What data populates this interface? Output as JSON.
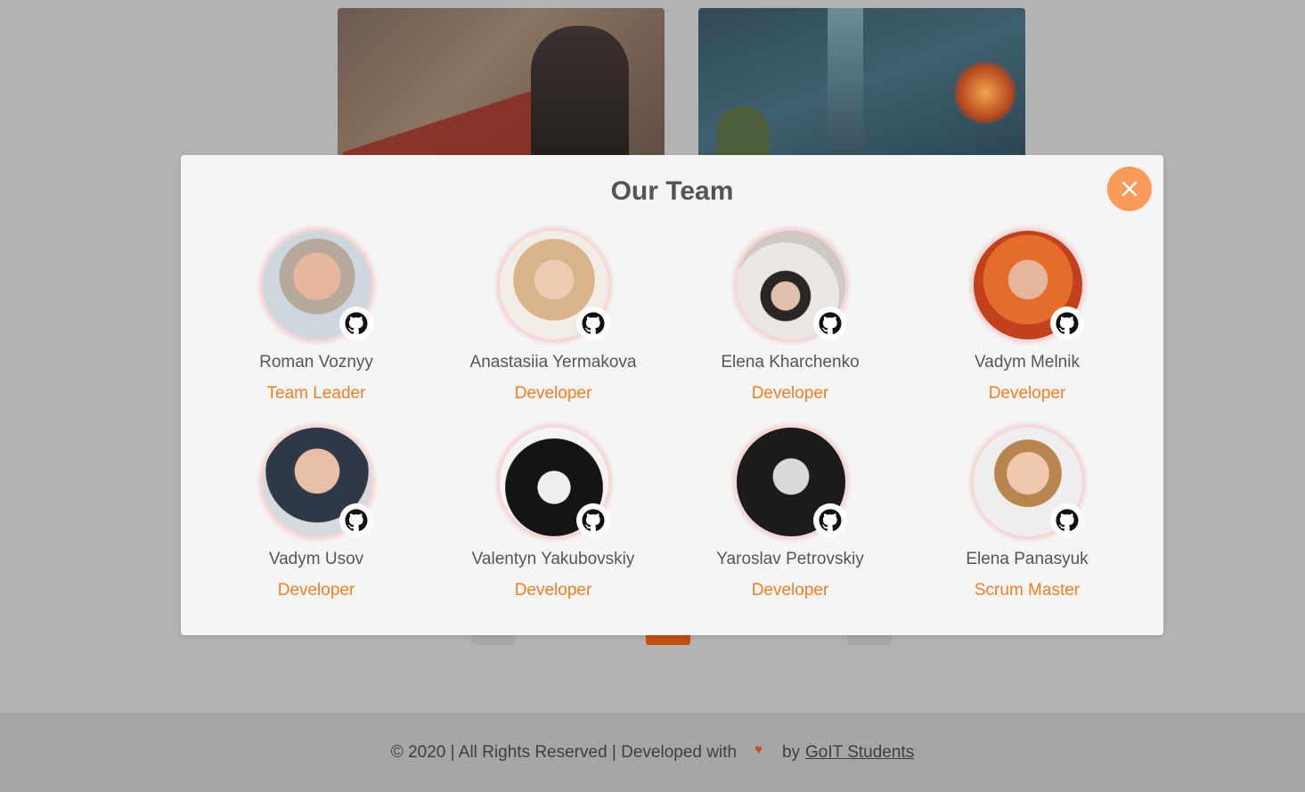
{
  "modal": {
    "title": "Our Team",
    "close_label": "×",
    "members": [
      {
        "name": "Roman Voznyy",
        "role": "Team Leader"
      },
      {
        "name": "Anastasiia Yermakova",
        "role": "Developer"
      },
      {
        "name": "Elena Kharchenko",
        "role": "Developer"
      },
      {
        "name": "Vadym Melnik",
        "role": "Developer"
      },
      {
        "name": "Vadym Usov",
        "role": "Developer"
      },
      {
        "name": "Valentyn Yakubovskiy",
        "role": "Developer"
      },
      {
        "name": "Yaroslav Petrovskiy",
        "role": "Developer"
      },
      {
        "name": "Elena Panasyuk",
        "role": "Scrum Master"
      }
    ]
  },
  "footer": {
    "text": "© 2020 | All Rights Reserved | Developed with",
    "heart": "♥",
    "by": "by",
    "link": "GoIT Students"
  },
  "colors": {
    "accent": "#f37d1f",
    "close_button": "#fb9b5a",
    "overlay_background": "#b3b3b3",
    "modal_background": "#f6f5f5",
    "active_page": "#c2500f"
  },
  "icons": {
    "close": "close-icon",
    "github": "github-icon",
    "heart": "heart-icon"
  }
}
